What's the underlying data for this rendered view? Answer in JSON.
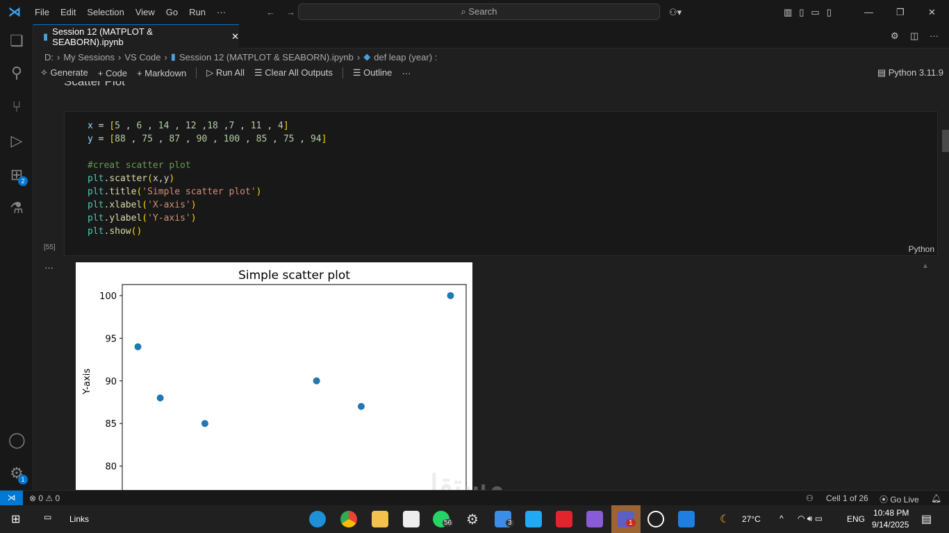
{
  "menu": [
    "File",
    "Edit",
    "Selection",
    "View",
    "Go",
    "Run",
    "···"
  ],
  "search": "Search",
  "tab": {
    "label": "Session 12 (MATPLOT & SEABORN).ipynb"
  },
  "breadcrumb": [
    "D:",
    "My Sessions",
    "VS Code",
    "Session 12 (MATPLOT & SEABORN).ipynb",
    "def leap (year) :"
  ],
  "toolbar": {
    "generate": "Generate",
    "code": "Code",
    "markdown": "Markdown",
    "run_all": "Run All",
    "clear": "Clear All Outputs",
    "outline": "Outline",
    "more": "···",
    "kernel": "Python 3.11.9"
  },
  "section_heading": "Scatter Plot",
  "cell": {
    "exec_count": "[55]",
    "language": "Python",
    "lines": [
      "x = [5 , 6 , 14 , 12 ,18 ,7 , 11 , 4]",
      "y = [88 , 75 , 87 , 90 , 100 , 85 , 75 , 94]",
      "",
      "#creat scatter plot",
      "plt.scatter(x,y)",
      "plt.title('Simple scatter plot')",
      "plt.xlabel('X-axis')",
      "plt.ylabel('Y-axis')",
      "plt.show()"
    ]
  },
  "output_more": "···",
  "chart_data": {
    "type": "scatter",
    "title": "Simple scatter plot",
    "xlabel": "X-axis",
    "ylabel": "Y-axis",
    "x": [
      5,
      6,
      14,
      12,
      18,
      7,
      11,
      4
    ],
    "y": [
      88,
      75,
      87,
      90,
      100,
      85,
      75,
      94
    ],
    "xlim": [
      3.3,
      18.7
    ],
    "ylim": [
      73.7,
      101.3
    ],
    "yticks": [
      80,
      85,
      90,
      95,
      100
    ],
    "color": "#1f77b4"
  },
  "status": {
    "errors": "0",
    "warnings": "0",
    "cell": "Cell 1 of 26",
    "golive": "Go Live"
  },
  "activity_badges": {
    "extensions": "2",
    "settings": "1"
  },
  "taskbar": {
    "links": "Links",
    "whatsapp_badge": "56",
    "explorer_badge": "3",
    "teams_badge": "1",
    "weather": "27°C",
    "lang": "ENG",
    "time": "10:48 PM",
    "date": "9/14/2025"
  }
}
